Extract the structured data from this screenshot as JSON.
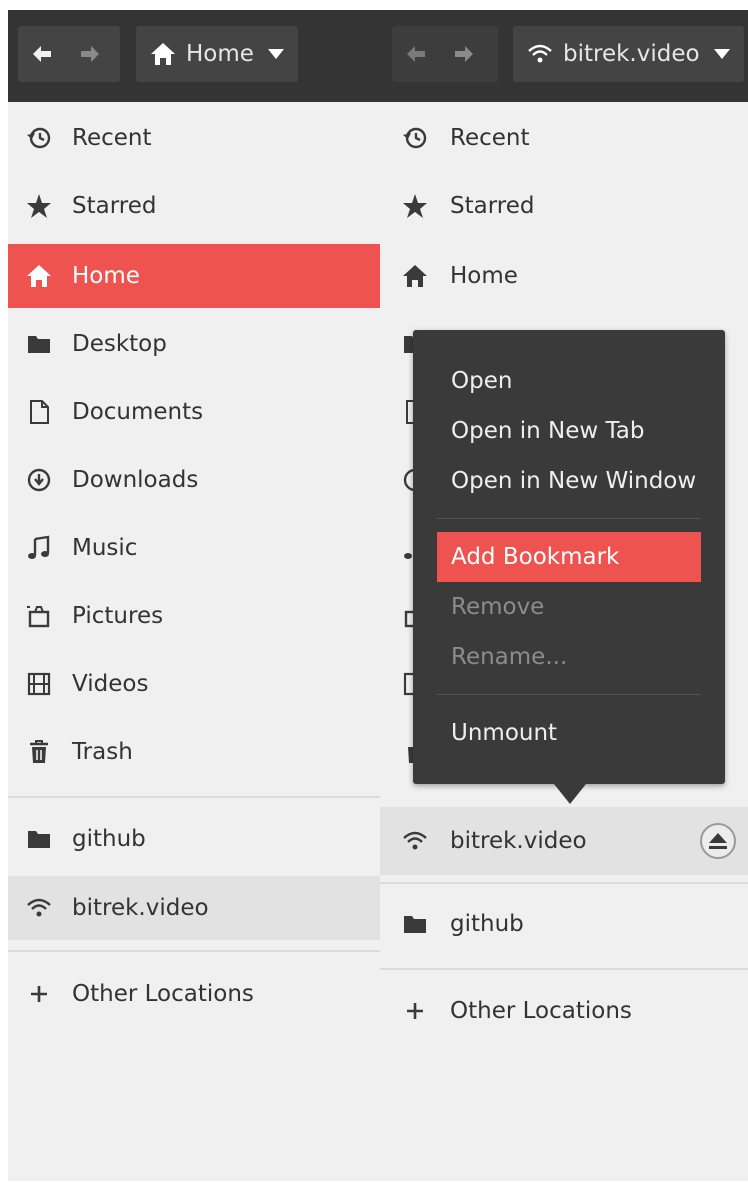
{
  "colors": {
    "accent": "#ef5350",
    "header": "#343434",
    "sidebar_bg": "#f0f0f0",
    "menu_bg": "#3a3a3a"
  },
  "left_pane": {
    "location_label": "Home",
    "items": [
      {
        "label": "Recent",
        "icon": "recent-icon"
      },
      {
        "label": "Starred",
        "icon": "star-icon"
      },
      {
        "label": "Home",
        "icon": "home-icon",
        "selected": true
      },
      {
        "label": "Desktop",
        "icon": "folder-icon"
      },
      {
        "label": "Documents",
        "icon": "document-icon"
      },
      {
        "label": "Downloads",
        "icon": "download-icon"
      },
      {
        "label": "Music",
        "icon": "music-icon"
      },
      {
        "label": "Pictures",
        "icon": "pictures-icon"
      },
      {
        "label": "Videos",
        "icon": "video-icon"
      },
      {
        "label": "Trash",
        "icon": "trash-icon"
      }
    ],
    "bookmarks": [
      {
        "label": "github",
        "icon": "folder-icon"
      },
      {
        "label": "bitrek.video",
        "icon": "wifi-icon"
      }
    ],
    "other_locations": "Other Locations"
  },
  "right_pane": {
    "location_label": "bitrek.video",
    "items": [
      {
        "label": "Recent",
        "icon": "recent-icon"
      },
      {
        "label": "Starred",
        "icon": "star-icon"
      },
      {
        "label": "Home",
        "icon": "home-icon"
      }
    ],
    "network": [
      {
        "label": "bitrek.video",
        "icon": "wifi-icon",
        "eject": "eject-icon"
      }
    ],
    "bookmarks": [
      {
        "label": "github",
        "icon": "folder-icon"
      }
    ],
    "other_locations": "Other Locations"
  },
  "context_menu": {
    "items": [
      {
        "label": "Open"
      },
      {
        "label": "Open in New Tab"
      },
      {
        "label": "Open in New Window"
      },
      {
        "label": "Add Bookmark",
        "active": true
      },
      {
        "label": "Remove",
        "disabled": true
      },
      {
        "label": "Rename...",
        "disabled": true
      },
      {
        "label": "Unmount"
      }
    ]
  }
}
